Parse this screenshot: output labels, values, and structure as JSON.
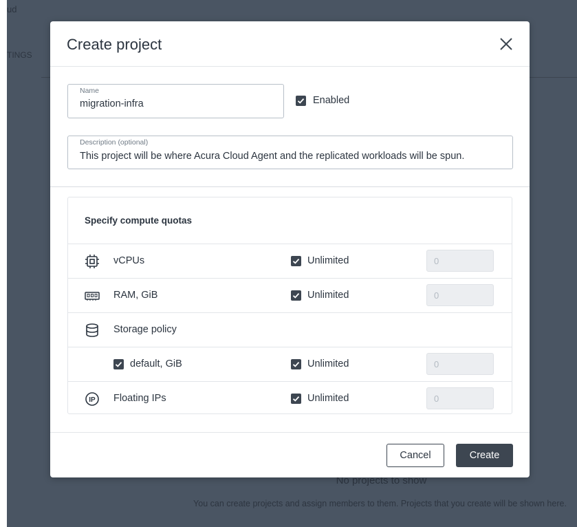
{
  "background": {
    "app_title_fragment": "ud",
    "tab_fragment": "TINGS",
    "empty_title": "No projects to show",
    "empty_description": "You can create projects and assign members to them. Projects that you create will be shown here."
  },
  "dialog": {
    "title": "Create project",
    "name_field": {
      "label": "Name",
      "value": "migration-infra"
    },
    "enabled": {
      "label": "Enabled",
      "checked": true
    },
    "description_field": {
      "label": "Description (optional)",
      "value": "This project will be where Acura Cloud Agent and the replicated workloads will be spun."
    },
    "quotas": {
      "title": "Specify compute quotas",
      "rows": [
        {
          "icon": "cpu-icon",
          "label": "vCPUs",
          "unlimited_label": "Unlimited",
          "unlimited_checked": true,
          "value": "0"
        },
        {
          "icon": "ram-icon",
          "label": "RAM, GiB",
          "unlimited_label": "Unlimited",
          "unlimited_checked": true,
          "value": "0"
        },
        {
          "icon": "database-icon",
          "label": "Storage policy"
        },
        {
          "label": "default, GiB",
          "checked": true,
          "unlimited_label": "Unlimited",
          "unlimited_checked": true,
          "value": "0"
        },
        {
          "icon": "floating-ip-icon",
          "label": "Floating IPs",
          "unlimited_label": "Unlimited",
          "unlimited_checked": true,
          "value": "0"
        }
      ]
    },
    "cancel_label": "Cancel",
    "create_label": "Create"
  },
  "colors": {
    "primary": "#3d4651",
    "backdrop": "#4a5563"
  }
}
